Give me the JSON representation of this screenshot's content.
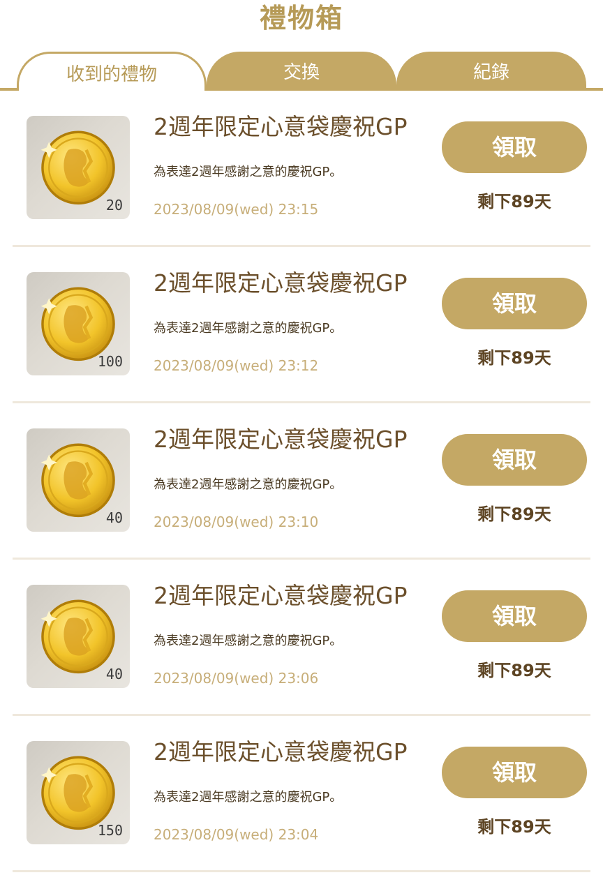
{
  "header": {
    "title": "禮物箱"
  },
  "tabs": [
    {
      "label": "收到的禮物",
      "active": true
    },
    {
      "label": "交換",
      "active": false
    },
    {
      "label": "紀錄",
      "active": false
    }
  ],
  "colors": {
    "accent_gold": "#c4a865",
    "title_gold": "#b69a57",
    "item_title_brown": "#6b4f2b",
    "date_gold": "#c7ae79"
  },
  "gifts": [
    {
      "icon": "gold-coin-icon",
      "quantity": "20",
      "title": "2週年限定心意袋慶祝GP",
      "description": "為表達2週年感謝之意的慶祝GP。",
      "date": "2023/08/09(wed) 23:15",
      "claim_label": "領取",
      "remaining": "剩下89天"
    },
    {
      "icon": "gold-coin-icon",
      "quantity": "100",
      "title": "2週年限定心意袋慶祝GP",
      "description": "為表達2週年感謝之意的慶祝GP。",
      "date": "2023/08/09(wed) 23:12",
      "claim_label": "領取",
      "remaining": "剩下89天"
    },
    {
      "icon": "gold-coin-icon",
      "quantity": "40",
      "title": "2週年限定心意袋慶祝GP",
      "description": "為表達2週年感謝之意的慶祝GP。",
      "date": "2023/08/09(wed) 23:10",
      "claim_label": "領取",
      "remaining": "剩下89天"
    },
    {
      "icon": "gold-coin-icon",
      "quantity": "40",
      "title": "2週年限定心意袋慶祝GP",
      "description": "為表達2週年感謝之意的慶祝GP。",
      "date": "2023/08/09(wed) 23:06",
      "claim_label": "領取",
      "remaining": "剩下89天"
    },
    {
      "icon": "gold-coin-icon",
      "quantity": "150",
      "title": "2週年限定心意袋慶祝GP",
      "description": "為表達2週年感謝之意的慶祝GP。",
      "date": "2023/08/09(wed) 23:04",
      "claim_label": "領取",
      "remaining": "剩下89天"
    }
  ]
}
